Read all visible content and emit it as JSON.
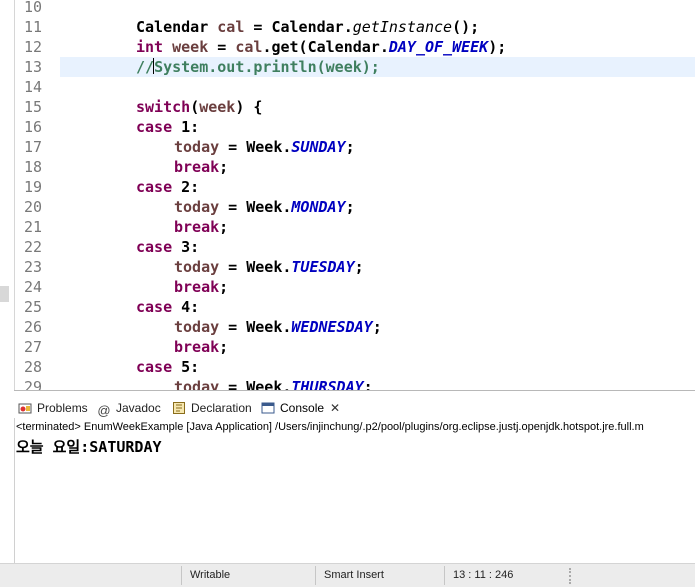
{
  "editor": {
    "lines": [
      {
        "num": "10",
        "tokens": []
      },
      {
        "num": "11",
        "tokens": [
          {
            "t": "Calendar ",
            "c": "plain"
          },
          {
            "t": "cal",
            "c": "var"
          },
          {
            "t": " = Calendar.",
            "c": "plain"
          },
          {
            "t": "getInstance",
            "c": "method"
          },
          {
            "t": "();",
            "c": "plain"
          }
        ]
      },
      {
        "num": "12",
        "tokens": [
          {
            "t": "int",
            "c": "kw"
          },
          {
            "t": " ",
            "c": "plain"
          },
          {
            "t": "week",
            "c": "var"
          },
          {
            "t": " = ",
            "c": "plain"
          },
          {
            "t": "cal",
            "c": "var"
          },
          {
            "t": ".get(Calendar.",
            "c": "plain"
          },
          {
            "t": "DAY_OF_WEEK",
            "c": "field"
          },
          {
            "t": ");",
            "c": "plain"
          }
        ]
      },
      {
        "num": "13",
        "highlight": true,
        "tokens": [
          {
            "t": "//",
            "c": "cmt"
          },
          {
            "t": "|",
            "c": "caret"
          },
          {
            "t": "System.out.println(week);",
            "c": "cmt"
          }
        ]
      },
      {
        "num": "14",
        "tokens": []
      },
      {
        "num": "15",
        "tokens": [
          {
            "t": "switch",
            "c": "kw"
          },
          {
            "t": "(",
            "c": "plain"
          },
          {
            "t": "week",
            "c": "var"
          },
          {
            "t": ") {",
            "c": "plain"
          }
        ]
      },
      {
        "num": "16",
        "tokens": [
          {
            "t": "case",
            "c": "kw"
          },
          {
            "t": " 1:",
            "c": "plain"
          }
        ]
      },
      {
        "num": "17",
        "indent": 1,
        "tokens": [
          {
            "t": "today",
            "c": "var"
          },
          {
            "t": " = Week.",
            "c": "plain"
          },
          {
            "t": "SUNDAY",
            "c": "field"
          },
          {
            "t": ";",
            "c": "plain"
          }
        ]
      },
      {
        "num": "18",
        "indent": 1,
        "tokens": [
          {
            "t": "break",
            "c": "kw"
          },
          {
            "t": ";",
            "c": "plain"
          }
        ]
      },
      {
        "num": "19",
        "tokens": [
          {
            "t": "case",
            "c": "kw"
          },
          {
            "t": " 2:",
            "c": "plain"
          }
        ]
      },
      {
        "num": "20",
        "indent": 1,
        "tokens": [
          {
            "t": "today",
            "c": "var"
          },
          {
            "t": " = Week.",
            "c": "plain"
          },
          {
            "t": "MONDAY",
            "c": "field"
          },
          {
            "t": ";",
            "c": "plain"
          }
        ]
      },
      {
        "num": "21",
        "indent": 1,
        "tokens": [
          {
            "t": "break",
            "c": "kw"
          },
          {
            "t": ";",
            "c": "plain"
          }
        ]
      },
      {
        "num": "22",
        "tokens": [
          {
            "t": "case",
            "c": "kw"
          },
          {
            "t": " 3:",
            "c": "plain"
          }
        ]
      },
      {
        "num": "23",
        "indent": 1,
        "tokens": [
          {
            "t": "today",
            "c": "var"
          },
          {
            "t": " = Week.",
            "c": "plain"
          },
          {
            "t": "TUESDAY",
            "c": "field"
          },
          {
            "t": ";",
            "c": "plain"
          }
        ]
      },
      {
        "num": "24",
        "indent": 1,
        "tokens": [
          {
            "t": "break",
            "c": "kw"
          },
          {
            "t": ";",
            "c": "plain"
          }
        ]
      },
      {
        "num": "25",
        "tokens": [
          {
            "t": "case",
            "c": "kw"
          },
          {
            "t": " 4:",
            "c": "plain"
          }
        ]
      },
      {
        "num": "26",
        "indent": 1,
        "tokens": [
          {
            "t": "today",
            "c": "var"
          },
          {
            "t": " = Week.",
            "c": "plain"
          },
          {
            "t": "WEDNESDAY",
            "c": "field"
          },
          {
            "t": ";",
            "c": "plain"
          }
        ]
      },
      {
        "num": "27",
        "indent": 1,
        "tokens": [
          {
            "t": "break",
            "c": "kw"
          },
          {
            "t": ";",
            "c": "plain"
          }
        ]
      },
      {
        "num": "28",
        "tokens": [
          {
            "t": "case",
            "c": "kw"
          },
          {
            "t": " 5:",
            "c": "plain"
          }
        ]
      },
      {
        "num": "29",
        "indent": 1,
        "tokens": [
          {
            "t": "today",
            "c": "var"
          },
          {
            "t": " = Week.",
            "c": "plain"
          },
          {
            "t": "THURSDAY",
            "c": "field"
          },
          {
            "t": ";",
            "c": "plain"
          }
        ]
      }
    ]
  },
  "tabs": {
    "problems": "Problems",
    "javadoc": "Javadoc",
    "declaration": "Declaration",
    "console": "Console",
    "javadoc_icon_text": "@"
  },
  "console": {
    "header": "<terminated> EnumWeekExample [Java Application] /Users/injinchung/.p2/pool/plugins/org.eclipse.justj.openjdk.hotspot.jre.full.m",
    "output": "오늘 요일:SATURDAY"
  },
  "statusbar": {
    "writable": "Writable",
    "insert_mode": "Smart Insert",
    "position": "13 : 11 : 246"
  },
  "colors": {
    "keyword": "#7f0055",
    "variable": "#6a3e3e",
    "field": "#0000c0",
    "comment": "#3f7f5f",
    "line_highlight": "#e8f2fe"
  }
}
